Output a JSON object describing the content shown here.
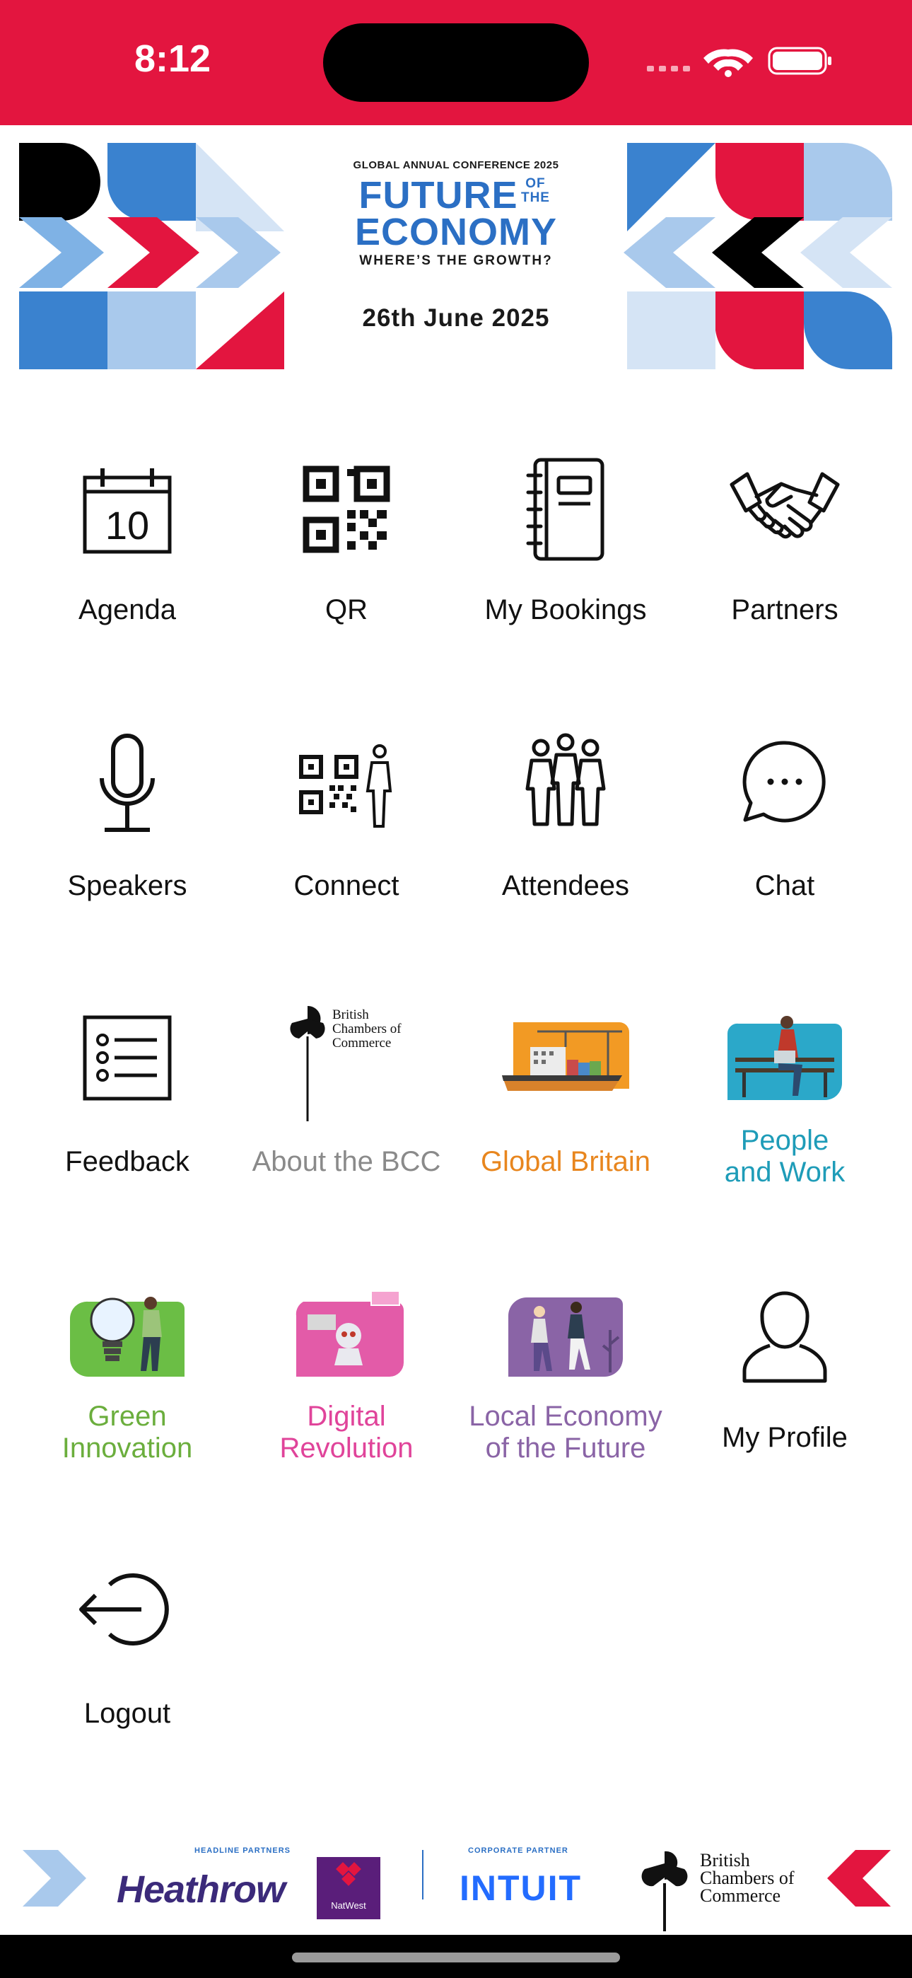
{
  "status": {
    "time": "8:12"
  },
  "banner": {
    "supertitle": "GLOBAL ANNUAL CONFERENCE 2025",
    "title_line1": "FUTURE",
    "title_of_the": "OF THE",
    "title_line2": "ECONOMY",
    "subtitle": "WHERE’S THE GROWTH?",
    "date": "26th June 2025"
  },
  "menu": [
    {
      "label": "Agenda",
      "icon": "calendar-icon",
      "calendar_day": "10"
    },
    {
      "label": "QR",
      "icon": "qr-code-icon"
    },
    {
      "label": "My Bookings",
      "icon": "notebook-icon"
    },
    {
      "label": "Partners",
      "icon": "handshake-icon"
    },
    {
      "label": "Speakers",
      "icon": "microphone-icon"
    },
    {
      "label": "Connect",
      "icon": "qr-person-icon"
    },
    {
      "label": "Attendees",
      "icon": "people-group-icon"
    },
    {
      "label": "Chat",
      "icon": "chat-bubble-icon"
    },
    {
      "label": "Feedback",
      "icon": "list-icon"
    },
    {
      "label": "About the BCC",
      "icon": "bcc-logo-icon",
      "color": "#8a8a8a",
      "logo_text": "British Chambers of Commerce"
    },
    {
      "label": "Global Britain",
      "icon": "cargo-ship-icon",
      "color": "#E8861E"
    },
    {
      "label_line1": "People",
      "label_line2": "and Work",
      "icon": "person-laptop-bench-icon",
      "color": "#1E9CB8"
    },
    {
      "label_line1": "Green",
      "label_line2": "Innovation",
      "icon": "lightbulb-person-icon",
      "color": "#6BAE3D"
    },
    {
      "label_line1": "Digital",
      "label_line2": "Revolution",
      "icon": "robot-icon",
      "color": "#E0449A"
    },
    {
      "label_line1": "Local Economy",
      "label_line2": "of the Future",
      "icon": "people-walking-icon",
      "color": "#8A64A6"
    },
    {
      "label": "My Profile",
      "icon": "user-icon"
    },
    {
      "label": "Logout",
      "icon": "logout-icon"
    }
  ],
  "footer": {
    "headline_tag": "HEADLINE PARTNERS",
    "heathrow": "Heathrow",
    "natwest": "NatWest",
    "corporate_tag": "CORPORATE PARTNER",
    "intuit": "INTUIT",
    "bcc_line1": "British",
    "bcc_line2": "Chambers of",
    "bcc_line3": "Commerce"
  },
  "colors": {
    "brand_red": "#E3153F",
    "brand_blue": "#2B6FC4",
    "light_blue": "#A9C9EC"
  }
}
